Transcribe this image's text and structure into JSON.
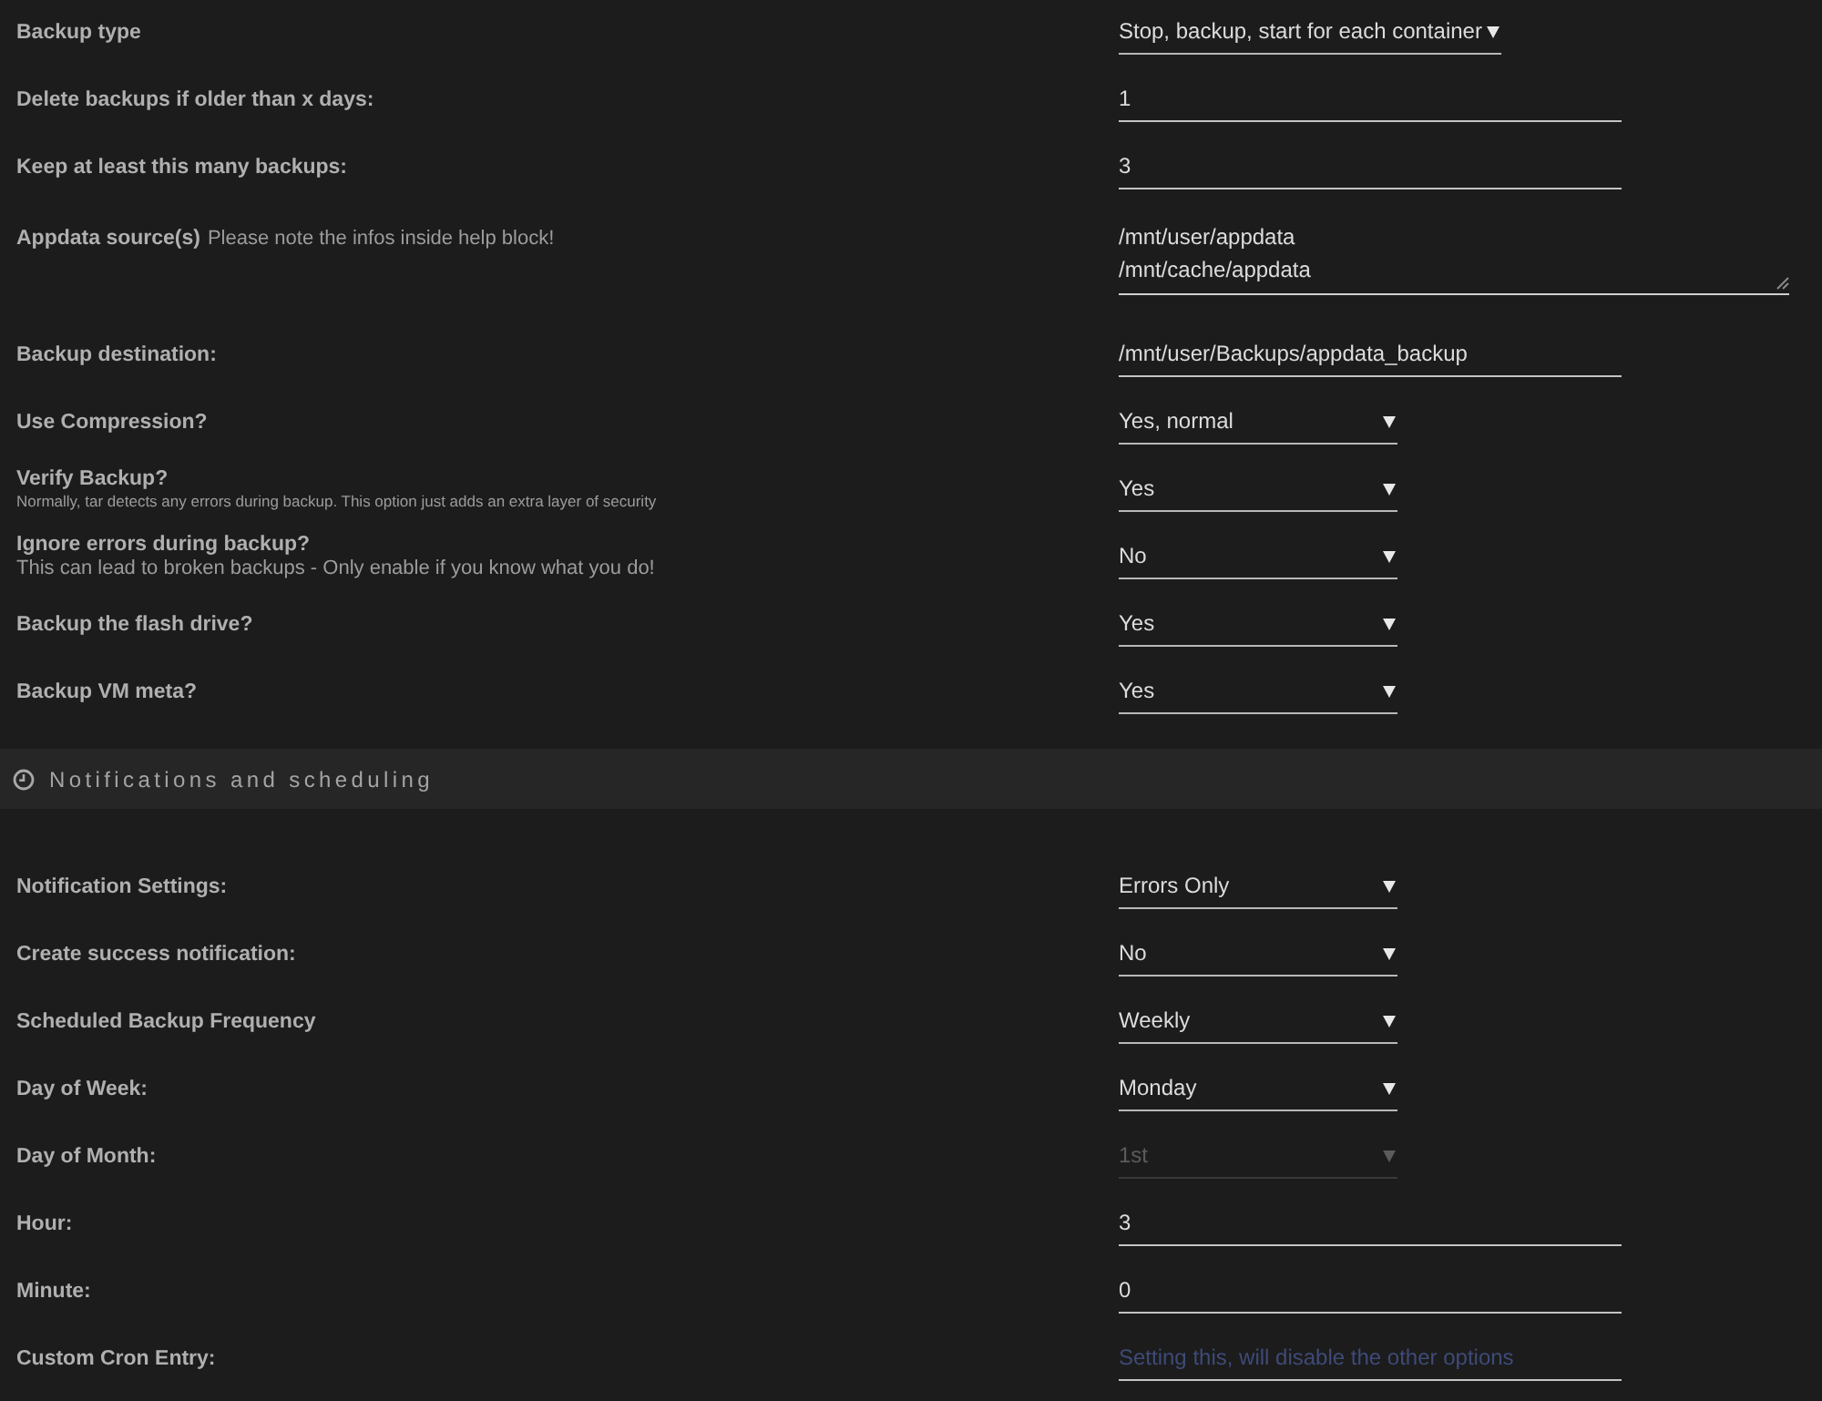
{
  "sections": [
    {
      "settings": [
        {
          "label": "Backup type",
          "control": {
            "kind": "select",
            "value": "Stop, backup, start for each container",
            "disabled": false
          }
        },
        {
          "label": "Delete backups if older than x days:",
          "control": {
            "kind": "input",
            "value": "1",
            "disabled": false
          }
        },
        {
          "label": "Keep at least this many backups:",
          "control": {
            "kind": "input",
            "value": "3",
            "disabled": false
          }
        },
        {
          "label": "Appdata source(s)",
          "note": "Please note the infos inside help block!",
          "control": {
            "kind": "textarea",
            "value": "/mnt/user/appdata\n/mnt/cache/appdata",
            "disabled": false
          }
        },
        {
          "label": "Backup destination:",
          "control": {
            "kind": "input",
            "value": "/mnt/user/Backups/appdata_backup",
            "disabled": false
          }
        },
        {
          "label": "Use Compression?",
          "control": {
            "kind": "select",
            "value": "Yes, normal",
            "disabled": false
          }
        },
        {
          "label": "Verify Backup?",
          "hint": "Normally, tar detects any errors during backup. This option just adds an extra layer of security",
          "control": {
            "kind": "select",
            "value": "Yes",
            "disabled": false
          }
        },
        {
          "label": "Ignore errors during backup?",
          "description": "This can lead to broken backups - Only enable if you know what you do!",
          "control": {
            "kind": "select",
            "value": "No",
            "disabled": false
          }
        },
        {
          "label": "Backup the flash drive?",
          "control": {
            "kind": "select",
            "value": "Yes",
            "disabled": false
          }
        },
        {
          "label": "Backup VM meta?",
          "control": {
            "kind": "select",
            "value": "Yes",
            "disabled": false
          }
        }
      ]
    },
    {
      "header": {
        "title": "Notifications and scheduling"
      },
      "settings": [
        {
          "label": "Notification Settings:",
          "control": {
            "kind": "select",
            "value": "Errors Only",
            "disabled": false
          }
        },
        {
          "label": "Create success notification:",
          "control": {
            "kind": "select",
            "value": "No",
            "disabled": false
          }
        },
        {
          "label": "Scheduled Backup Frequency",
          "control": {
            "kind": "select",
            "value": "Weekly",
            "disabled": false
          }
        },
        {
          "label": "Day of Week:",
          "control": {
            "kind": "select",
            "value": "Monday",
            "disabled": false
          }
        },
        {
          "label": "Day of Month:",
          "control": {
            "kind": "select",
            "value": "1st",
            "disabled": true
          }
        },
        {
          "label": "Hour:",
          "control": {
            "kind": "input",
            "value": "3",
            "disabled": false
          }
        },
        {
          "label": "Minute:",
          "control": {
            "kind": "input",
            "value": "0",
            "disabled": false
          }
        },
        {
          "label": "Custom Cron Entry:",
          "control": {
            "kind": "input",
            "placeholder": "Setting this, will disable the other options",
            "disabled": false
          }
        }
      ]
    }
  ]
}
